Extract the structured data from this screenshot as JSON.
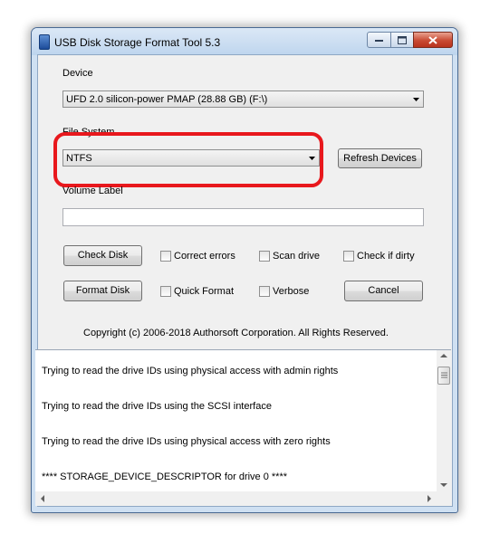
{
  "window": {
    "title": "USB Disk Storage Format Tool 5.3"
  },
  "device": {
    "label": "Device",
    "selected": "UFD 2.0  silicon-power  PMAP (28.88 GB) (F:\\)"
  },
  "file_system": {
    "label": "File System",
    "selected": "NTFS"
  },
  "refresh_button": "Refresh Devices",
  "volume_label": {
    "label": "Volume Label",
    "value": ""
  },
  "buttons": {
    "check_disk": "Check Disk",
    "format_disk": "Format Disk",
    "cancel": "Cancel"
  },
  "options": {
    "correct_errors": "Correct errors",
    "scan_drive": "Scan drive",
    "check_if_dirty": "Check if dirty",
    "quick_format": "Quick Format",
    "verbose": "Verbose"
  },
  "copyright": "Copyright (c) 2006-2018 Authorsoft Corporation. All Rights Reserved.",
  "log": {
    "lines": [
      "Trying to read the drive IDs using physical access with admin rights",
      "Trying to read the drive IDs using the SCSI interface",
      "Trying to read the drive IDs using physical access with zero rights",
      "**** STORAGE_DEVICE_DESCRIPTOR for drive 0 ****"
    ]
  },
  "colors": {
    "highlight": "#e8181d",
    "window_frame": "#cfe0f2",
    "client_background": "#f0f0f0",
    "close_button": "#c94a33"
  }
}
